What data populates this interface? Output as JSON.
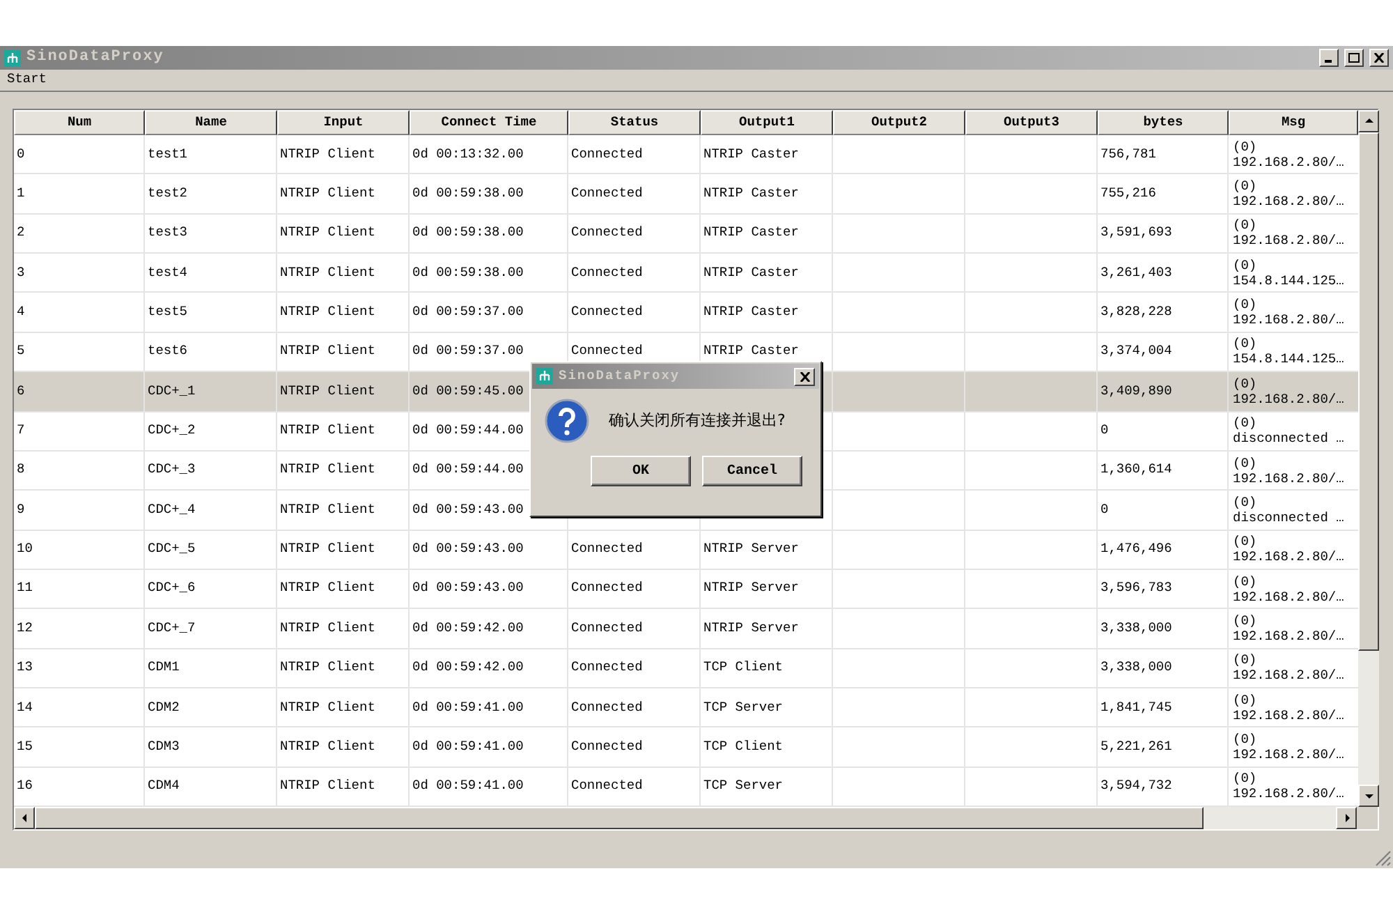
{
  "window": {
    "title": "SinoDataProxy"
  },
  "menu": [
    "Start"
  ],
  "table": {
    "columns": [
      "Num",
      "Name",
      "Input",
      "Connect Time",
      "Status",
      "Output1",
      "Output2",
      "Output3",
      "bytes",
      "Msg"
    ],
    "rows": [
      {
        "num": "0",
        "name": "test1",
        "input": "NTRIP Client",
        "connect_time": "0d 00:13:32.00",
        "status": "Connected",
        "output1": "NTRIP Caster",
        "bytes": "756,781",
        "msg": [
          "(0)",
          "192.168.2.80/…"
        ],
        "selected": false
      },
      {
        "num": "1",
        "name": "test2",
        "input": "NTRIP Client",
        "connect_time": "0d 00:59:38.00",
        "status": "Connected",
        "output1": "NTRIP Caster",
        "bytes": "755,216",
        "msg": [
          "(0)",
          "192.168.2.80/…"
        ],
        "selected": false
      },
      {
        "num": "2",
        "name": "test3",
        "input": "NTRIP Client",
        "connect_time": "0d 00:59:38.00",
        "status": "Connected",
        "output1": "NTRIP Caster",
        "bytes": "3,591,693",
        "msg": [
          "(0)",
          "192.168.2.80/…"
        ],
        "selected": false
      },
      {
        "num": "3",
        "name": "test4",
        "input": "NTRIP Client",
        "connect_time": "0d 00:59:38.00",
        "status": "Connected",
        "output1": "NTRIP Caster",
        "bytes": "3,261,403",
        "msg": [
          "(0)",
          "154.8.144.125…"
        ],
        "selected": false
      },
      {
        "num": "4",
        "name": "test5",
        "input": "NTRIP Client",
        "connect_time": "0d 00:59:37.00",
        "status": "Connected",
        "output1": "NTRIP Caster",
        "bytes": "3,828,228",
        "msg": [
          "(0)",
          "192.168.2.80/…"
        ],
        "selected": false
      },
      {
        "num": "5",
        "name": "test6",
        "input": "NTRIP Client",
        "connect_time": "0d 00:59:37.00",
        "status": "Connected",
        "output1": "NTRIP Caster",
        "bytes": "3,374,004",
        "msg": [
          "(0)",
          "154.8.144.125…"
        ],
        "selected": false
      },
      {
        "num": "6",
        "name": "CDC+_1",
        "input": "NTRIP Client",
        "connect_time": "0d 00:59:45.00",
        "bytes": "3,409,890",
        "msg": [
          "(0)",
          "192.168.2.80/…"
        ],
        "selected": true
      },
      {
        "num": "7",
        "name": "CDC+_2",
        "input": "NTRIP Client",
        "connect_time": "0d 00:59:44.00",
        "bytes": "0",
        "msg": [
          "(0)",
          "disconnected …"
        ],
        "selected": false
      },
      {
        "num": "8",
        "name": "CDC+_3",
        "input": "NTRIP Client",
        "connect_time": "0d 00:59:44.00",
        "bytes": "1,360,614",
        "msg": [
          "(0)",
          "192.168.2.80/…"
        ],
        "selected": false
      },
      {
        "num": "9",
        "name": "CDC+_4",
        "input": "NTRIP Client",
        "connect_time": "0d 00:59:43.00",
        "bytes": "0",
        "msg": [
          "(0)",
          "disconnected …"
        ],
        "selected": false
      },
      {
        "num": "10",
        "name": "CDC+_5",
        "input": "NTRIP Client",
        "connect_time": "0d 00:59:43.00",
        "status": "Connected",
        "output1": "NTRIP Server",
        "bytes": "1,476,496",
        "msg": [
          "(0)",
          "192.168.2.80/…"
        ],
        "selected": false
      },
      {
        "num": "11",
        "name": "CDC+_6",
        "input": "NTRIP Client",
        "connect_time": "0d 00:59:43.00",
        "status": "Connected",
        "output1": "NTRIP Server",
        "bytes": "3,596,783",
        "msg": [
          "(0)",
          "192.168.2.80/…"
        ],
        "selected": false
      },
      {
        "num": "12",
        "name": "CDC+_7",
        "input": "NTRIP Client",
        "connect_time": "0d 00:59:42.00",
        "status": "Connected",
        "output1": "NTRIP Server",
        "bytes": "3,338,000",
        "msg": [
          "(0)",
          "192.168.2.80/…"
        ],
        "selected": false
      },
      {
        "num": "13",
        "name": "CDM1",
        "input": "NTRIP Client",
        "connect_time": "0d 00:59:42.00",
        "status": "Connected",
        "output1": "TCP Client",
        "bytes": "3,338,000",
        "msg": [
          "(0)",
          "192.168.2.80/…"
        ],
        "selected": false
      },
      {
        "num": "14",
        "name": "CDM2",
        "input": "NTRIP Client",
        "connect_time": "0d 00:59:41.00",
        "status": "Connected",
        "output1": "TCP Server",
        "bytes": "1,841,745",
        "msg": [
          "(0)",
          "192.168.2.80/…"
        ],
        "selected": false
      },
      {
        "num": "15",
        "name": "CDM3",
        "input": "NTRIP Client",
        "connect_time": "0d 00:59:41.00",
        "status": "Connected",
        "output1": "TCP Client",
        "bytes": "5,221,261",
        "msg": [
          "(0)",
          "192.168.2.80/…"
        ],
        "selected": false
      },
      {
        "num": "16",
        "name": "CDM4",
        "input": "NTRIP Client",
        "connect_time": "0d 00:59:41.00",
        "status": "Connected",
        "output1": "TCP Server",
        "bytes": "3,594,732",
        "msg": [
          "(0)",
          "192.168.2.80/…"
        ],
        "selected": false
      }
    ]
  },
  "dialog": {
    "title": "SinoDataProxy",
    "message": "确认关闭所有连接并退出?",
    "buttons": [
      "OK",
      "Cancel"
    ]
  }
}
